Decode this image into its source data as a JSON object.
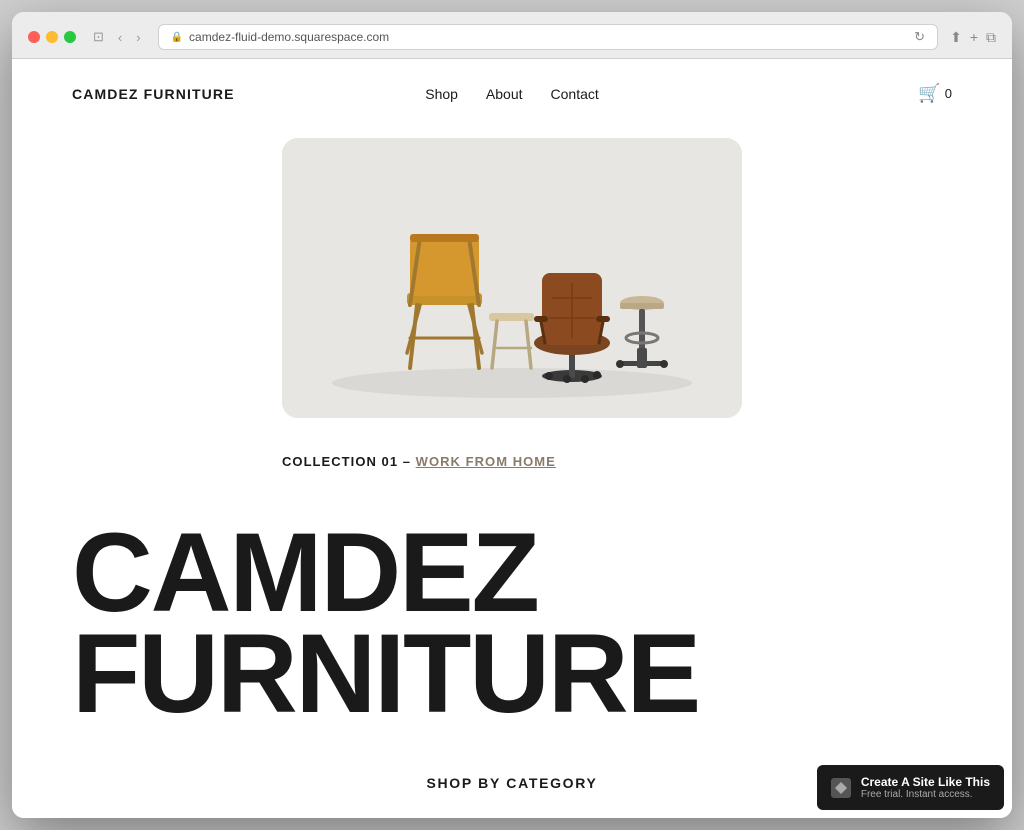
{
  "browser": {
    "url": "camdez-fluid-demo.squarespace.com",
    "title": "Camdez Furniture"
  },
  "navbar": {
    "brand": "CAMDEZ FURNITURE",
    "links": [
      {
        "label": "Shop",
        "href": "#"
      },
      {
        "label": "About",
        "href": "#"
      },
      {
        "label": "Contact",
        "href": "#"
      }
    ],
    "cart_count": "0"
  },
  "hero": {
    "collection_prefix": "COLLECTION 01 – ",
    "collection_link": "WORK FROM HOME",
    "hero_title": "CAMDEZ FURNITURE"
  },
  "category": {
    "title": "SHOP BY CATEGORY"
  },
  "banner": {
    "icon": "◻",
    "main_text": "Create A Site Like This",
    "sub_text": "Free trial. Instant access."
  }
}
